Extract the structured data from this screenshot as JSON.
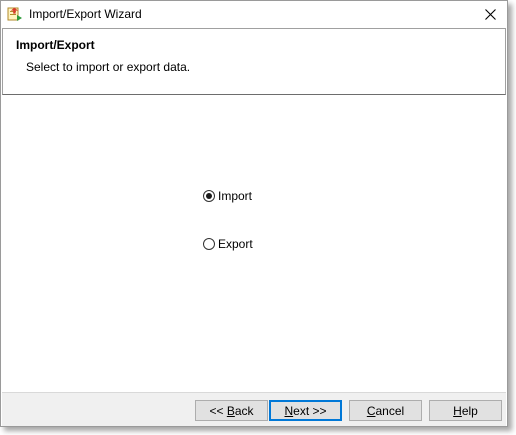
{
  "window": {
    "title": "Import/Export Wizard",
    "close_glyph": "✕"
  },
  "header": {
    "title": "Import/Export",
    "subtitle": "Select to import or export data."
  },
  "options": {
    "import_label": "Import",
    "export_label": "Export",
    "selected": "Import"
  },
  "buttons": {
    "back_prefix": "<< ",
    "back_hotkey": "B",
    "back_rest": "ack",
    "next_hotkey": "N",
    "next_rest": "ext >>",
    "cancel_hotkey": "C",
    "cancel_rest": "ancel",
    "help_hotkey": "H",
    "help_rest": "elp"
  },
  "colors": {
    "focus_border": "#0078d7",
    "footer_bg": "#f0f0f0"
  },
  "icons": {
    "app": "wizard-app-icon",
    "close": "close-icon"
  }
}
